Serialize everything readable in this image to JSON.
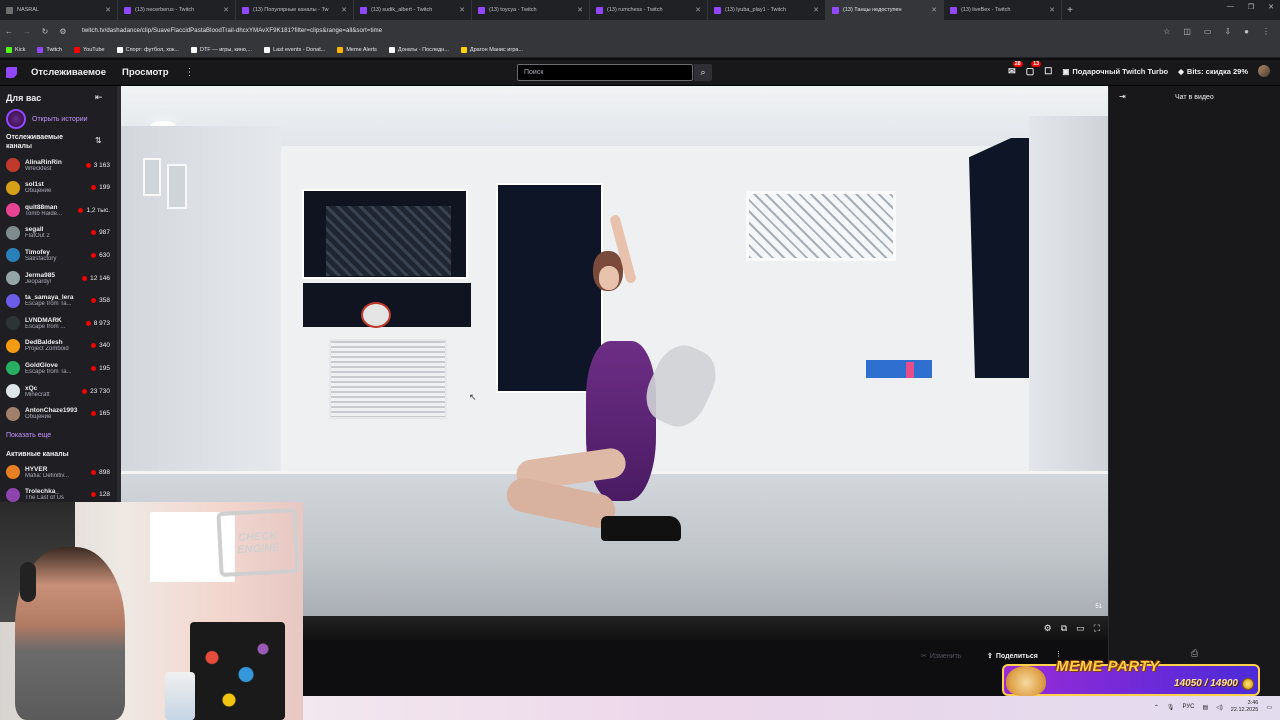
{
  "browser": {
    "tabs": [
      {
        "title": "NASRAL",
        "active": false,
        "favicon": "generic"
      },
      {
        "title": "(13) necerberus - Twitch",
        "active": false,
        "favicon": "twitch"
      },
      {
        "title": "(13) Популярные каналы - Tw",
        "active": false,
        "favicon": "twitch"
      },
      {
        "title": "(13) sudik_albert - Twitch",
        "active": false,
        "favicon": "twitch"
      },
      {
        "title": "(13) toycya - Twitch",
        "active": false,
        "favicon": "twitch"
      },
      {
        "title": "(13) rumchess - Twitch",
        "active": false,
        "favicon": "twitch"
      },
      {
        "title": "(13) lyuba_play1 - Twitch",
        "active": false,
        "favicon": "twitch"
      },
      {
        "title": "(13) Танцы недоступен",
        "active": true,
        "favicon": "twitch"
      },
      {
        "title": "(13) liveBex - Twitch",
        "active": false,
        "favicon": "twitch"
      }
    ],
    "new_tab": "+",
    "url": "twitch.tv/dashadance/clip/SuaveFlaccidPastaBloodTrail-dhcxYMAvXF9K181?filter=clips&range=all&sort=time",
    "bookmarks": [
      {
        "label": "Kick",
        "color": "#53fc18"
      },
      {
        "label": "Twitch",
        "color": "#9146ff"
      },
      {
        "label": "YouTube",
        "color": "#ff0000"
      },
      {
        "label": "Спорт: футбол, хок...",
        "color": "#ffffff"
      },
      {
        "label": "DTF — игры, кино,...",
        "color": "#ffffff"
      },
      {
        "label": "Last events - Donat...",
        "color": "#ffffff"
      },
      {
        "label": "Meme Alerts",
        "color": "#ffb703"
      },
      {
        "label": "Донаты - Последн...",
        "color": "#ffffff"
      },
      {
        "label": "Драгон Манис игра...",
        "color": "#ffd400"
      }
    ]
  },
  "twitch_nav": {
    "following": "Отслеживаемое",
    "browse": "Просмотр",
    "search_placeholder": "Поиск",
    "notif_badge_1": "28",
    "notif_badge_2": "13",
    "turbo": "Подарочный Twitch Turbo",
    "bits": "Bits: скидка 29%"
  },
  "sidebar": {
    "title": "Для вас",
    "stories": "Открыть истории",
    "followed_title": "Отслеживаемые каналы",
    "channels": [
      {
        "name": "AlinaRinRin",
        "game": "Wreckfest",
        "viewers": "3 163",
        "color": "#c0392b"
      },
      {
        "name": "sol1st",
        "game": "Общение",
        "viewers": "199",
        "color": "#d4a017"
      },
      {
        "name": "quit88man",
        "game": "Tomb Raide...",
        "viewers": "1,2 тыс.",
        "color": "#e84393"
      },
      {
        "name": "segall",
        "game": "FlatOut 2",
        "viewers": "987",
        "color": "#7f8c8d"
      },
      {
        "name": "Timofey",
        "game": "Satisfactory",
        "viewers": "630",
        "color": "#2980b9"
      },
      {
        "name": "Jerma985",
        "game": "Jeopardy!",
        "viewers": "12 146",
        "color": "#95a5a6"
      },
      {
        "name": "ta_samaya_lera",
        "game": "Escape from Ta...",
        "viewers": "358",
        "color": "#6c5ce7"
      },
      {
        "name": "LVNDMARK",
        "game": "Escape from ...",
        "viewers": "8 973",
        "color": "#2d3436"
      },
      {
        "name": "DedBaldesh",
        "game": "Project Zomboid",
        "viewers": "340",
        "color": "#f39c12"
      },
      {
        "name": "GoldGlove",
        "game": "Escape from Ta...",
        "viewers": "195",
        "color": "#27ae60"
      },
      {
        "name": "xQc",
        "game": "Minecraft",
        "viewers": "23 730",
        "color": "#dfe6e9"
      },
      {
        "name": "AntonChaze1993",
        "game": "Общение",
        "viewers": "165",
        "color": "#a0806a"
      }
    ],
    "show_more": "Показать еще",
    "active_title": "Активные каналы",
    "active_channels": [
      {
        "name": "HYVER",
        "game": "Mafia: Definitiv...",
        "viewers": "898",
        "color": "#e67e22"
      },
      {
        "name": "Trolechka_",
        "game": "The Last of Us",
        "viewers": "128",
        "color": "#8e44ad"
      }
    ]
  },
  "video": {
    "time_badge": "51",
    "edit": "Изменить",
    "share": "Поделиться"
  },
  "chat": {
    "title": "Чат в видео"
  },
  "webcam": {
    "sign_text": "CHECK ENGINE"
  },
  "meme_party": {
    "title": "MEME PARTY",
    "count": "14050 / 14900"
  },
  "taskbar": {
    "lang": "РУС",
    "time": "3:46",
    "date": "22.12.2025"
  }
}
